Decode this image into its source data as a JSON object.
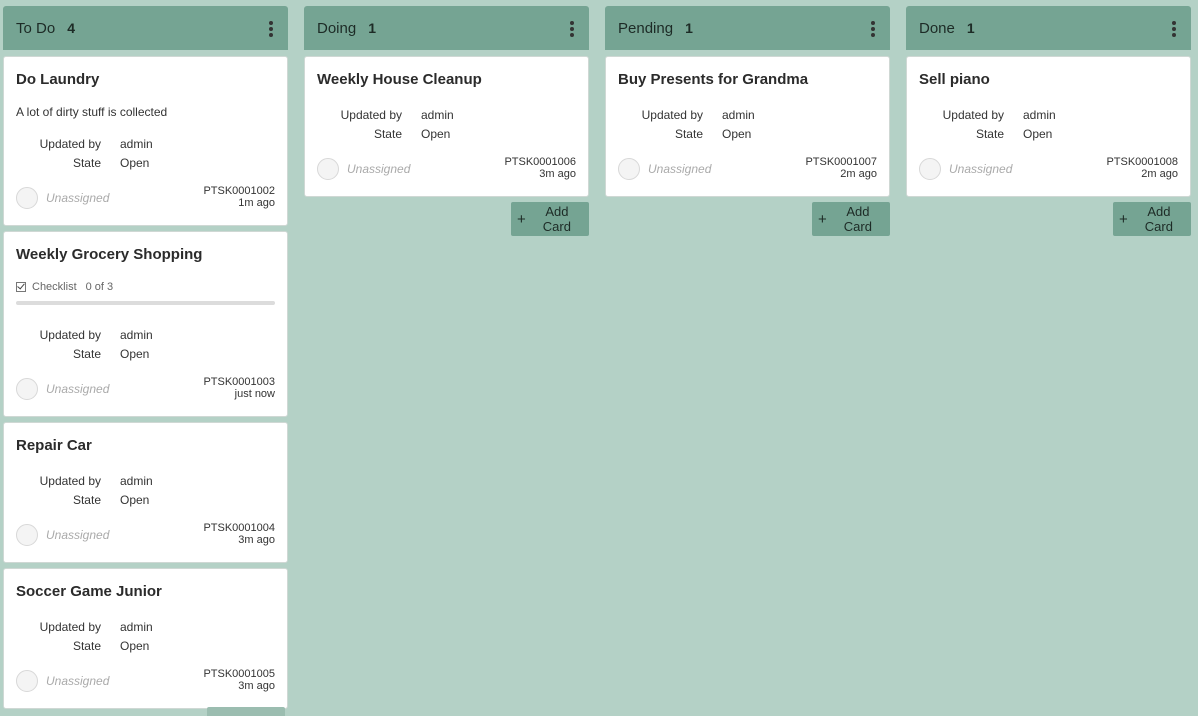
{
  "lanes": [
    {
      "title": "To Do",
      "count": "4",
      "cards": [
        {
          "title": "Do Laundry",
          "description": "A lot of dirty stuff is collected",
          "updated_by_label": "Updated by",
          "updated_by": "admin",
          "state_label": "State",
          "state": "Open",
          "assignee": "Unassigned",
          "number": "PTSK0001002",
          "time": "1m ago"
        },
        {
          "title": "Weekly Grocery Shopping",
          "checklist_label": "Checklist",
          "checklist_count": "0 of 3",
          "checklist_progress": 0,
          "updated_by_label": "Updated by",
          "updated_by": "admin",
          "state_label": "State",
          "state": "Open",
          "assignee": "Unassigned",
          "number": "PTSK0001003",
          "time": "just now"
        },
        {
          "title": "Repair Car",
          "updated_by_label": "Updated by",
          "updated_by": "admin",
          "state_label": "State",
          "state": "Open",
          "assignee": "Unassigned",
          "number": "PTSK0001004",
          "time": "3m ago"
        },
        {
          "title": "Soccer Game Junior",
          "updated_by_label": "Updated by",
          "updated_by": "admin",
          "state_label": "State",
          "state": "Open",
          "assignee": "Unassigned",
          "number": "PTSK0001005",
          "time": "3m ago"
        }
      ]
    },
    {
      "title": "Doing",
      "count": "1",
      "add_card_label": "Add Card",
      "cards": [
        {
          "title": "Weekly House Cleanup",
          "updated_by_label": "Updated by",
          "updated_by": "admin",
          "state_label": "State",
          "state": "Open",
          "assignee": "Unassigned",
          "number": "PTSK0001006",
          "time": "3m ago"
        }
      ]
    },
    {
      "title": "Pending",
      "count": "1",
      "add_card_label": "Add Card",
      "cards": [
        {
          "title": "Buy Presents for Grandma",
          "updated_by_label": "Updated by",
          "updated_by": "admin",
          "state_label": "State",
          "state": "Open",
          "assignee": "Unassigned",
          "number": "PTSK0001007",
          "time": "2m ago"
        }
      ]
    },
    {
      "title": "Done",
      "count": "1",
      "add_card_label": "Add Card",
      "cards": [
        {
          "title": "Sell piano",
          "updated_by_label": "Updated by",
          "updated_by": "admin",
          "state_label": "State",
          "state": "Open",
          "assignee": "Unassigned",
          "number": "PTSK0001008",
          "time": "2m ago"
        }
      ]
    }
  ],
  "icons": {
    "add": "plus-icon",
    "menu": "kebab-menu-icon",
    "checklist": "checkbox-icon",
    "avatar": "avatar-placeholder-icon"
  },
  "colors": {
    "board_bg": "#b4d1c6",
    "lane_header": "#75a493",
    "card_bg": "#ffffff",
    "muted_text": "#aaaaaa"
  }
}
